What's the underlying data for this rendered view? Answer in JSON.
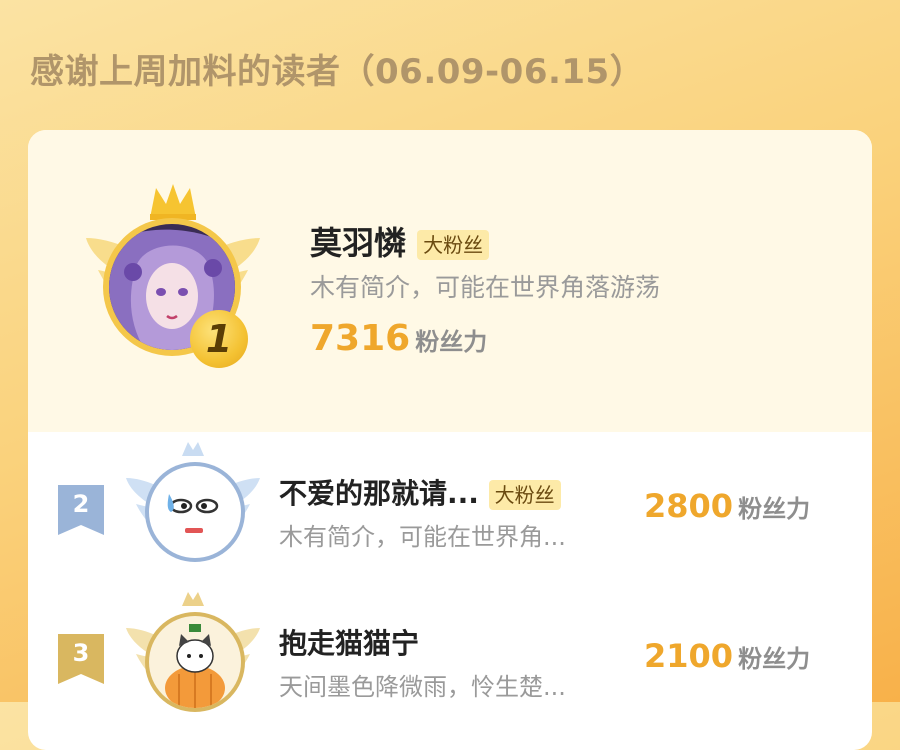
{
  "title": "感谢上周加料的读者（06.09-06.15）",
  "top1": {
    "rank": "1",
    "name": "莫羽憐",
    "badge": "大粉丝",
    "bio": "木有简介，可能在世界角落游荡",
    "score": "7316",
    "unit": "粉丝力"
  },
  "list": [
    {
      "rank": "2",
      "name": "不爱的那就请...",
      "badge": "大粉丝",
      "bio": "木有简介，可能在世界角...",
      "score": "2800",
      "unit": "粉丝力"
    },
    {
      "rank": "3",
      "name": "抱走猫猫宁",
      "badge": "",
      "bio": "天间墨色降微雨，怜生楚...",
      "score": "2100",
      "unit": "粉丝力"
    }
  ],
  "colors": {
    "accent": "#efa72c",
    "gold": "#f3c23b",
    "silver": "#9ab4d8",
    "bronze": "#d9b760"
  }
}
